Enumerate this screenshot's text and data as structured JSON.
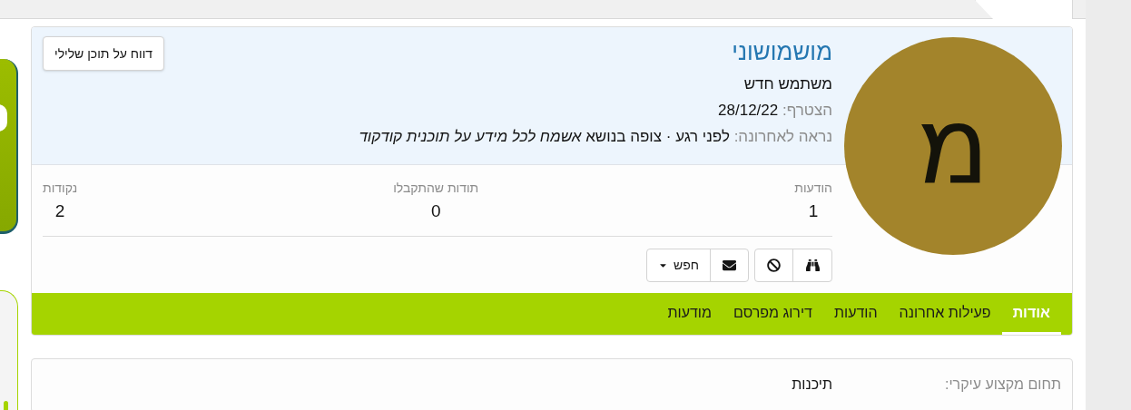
{
  "profile": {
    "avatar_letter": "מ",
    "name": "מושמושוני",
    "user_title": "משתמש חדש",
    "joined": {
      "label": "הצטרף:",
      "value": "28/12/22"
    },
    "last_seen": {
      "label": "נראה לאחרונה:",
      "value": "לפני רגע · צופה בנושא *אשמח לכל מידע על תוכנית קודקוד*"
    },
    "report_button": "דווח על תוכן שלילי"
  },
  "stats": [
    {
      "label": "הודעות",
      "value": "1"
    },
    {
      "label": "תודות שהתקבלו",
      "value": "0"
    },
    {
      "label": "נקודות",
      "value": "2"
    }
  ],
  "actions": {
    "find_button": "חפש"
  },
  "tabs": [
    {
      "label": "אודות",
      "selected": true
    },
    {
      "label": "פעילות אחרונה",
      "selected": false
    },
    {
      "label": "הודעות",
      "selected": false
    },
    {
      "label": "דירוג מפרסם",
      "selected": false
    },
    {
      "label": "מודעות",
      "selected": false
    }
  ],
  "about": [
    {
      "label": "תחום מקצוע עיקרי:",
      "value": "תיכנות"
    }
  ]
}
